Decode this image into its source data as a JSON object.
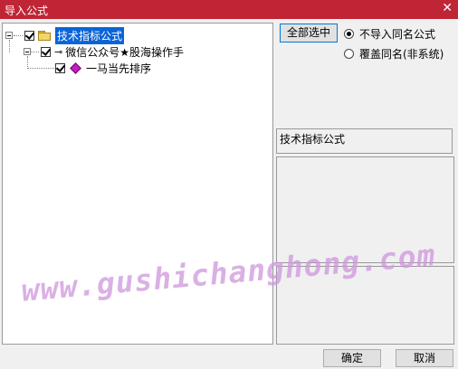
{
  "window": {
    "title": "导入公式",
    "close_glyph": "✕"
  },
  "tree": {
    "root": {
      "label": "技术指标公式",
      "checked": true
    },
    "child": {
      "label": "微信公众号★股海操作手",
      "checked": true
    },
    "leaf": {
      "label": "一马当先排序",
      "checked": true
    }
  },
  "options": {
    "select_all_label": "全部选中",
    "radio_skip_label": "不导入同名公式",
    "radio_overwrite_label": "覆盖同名(非系统)",
    "selected": "skip"
  },
  "info": {
    "category_label": "技术指标公式"
  },
  "buttons": {
    "ok_label": "确定",
    "cancel_label": "取消"
  },
  "watermark": {
    "text": "www.gushichanghong.com"
  },
  "colors": {
    "titlebar": "#c02535",
    "selection": "#0a64d8",
    "watermark": "#cd96dc"
  }
}
